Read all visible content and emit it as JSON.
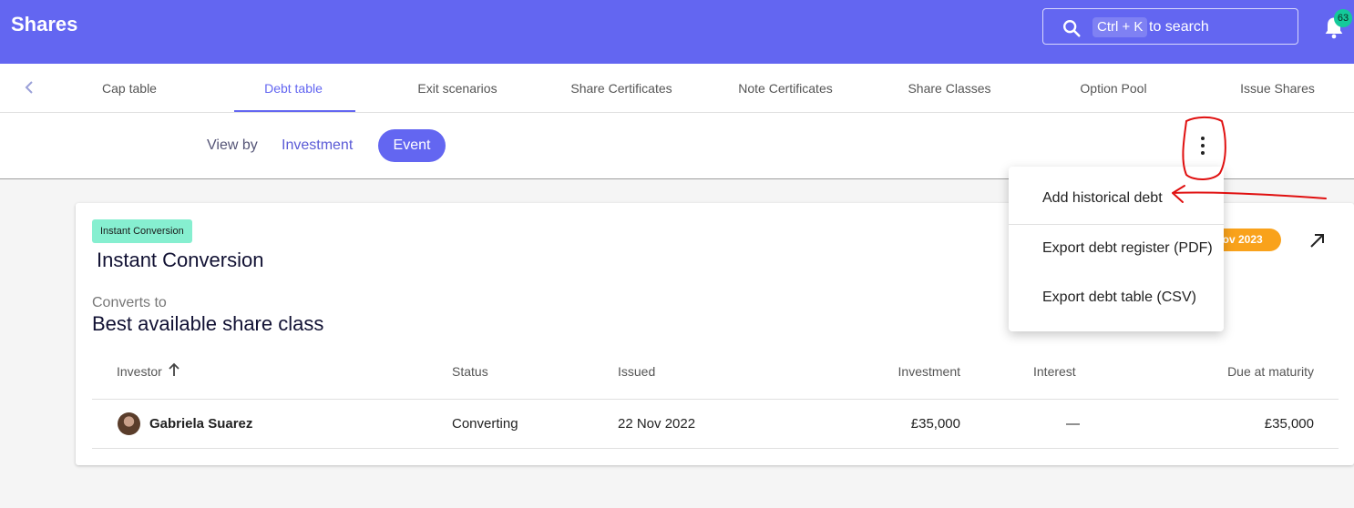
{
  "header": {
    "title": "Shares",
    "search": {
      "shortcut": "Ctrl + K",
      "label": "to search"
    },
    "notifications": {
      "count": "63"
    }
  },
  "tabs": [
    {
      "label": "Cap table"
    },
    {
      "label": "Debt table"
    },
    {
      "label": "Exit scenarios"
    },
    {
      "label": "Share Certificates"
    },
    {
      "label": "Note Certificates"
    },
    {
      "label": "Share Classes"
    },
    {
      "label": "Option Pool"
    },
    {
      "label": "Issue Shares"
    }
  ],
  "active_tab": "Debt table",
  "view_by": {
    "label": "View by",
    "options": [
      "Investment",
      "Event"
    ],
    "selected": "Event"
  },
  "menu": {
    "items": [
      {
        "label": "Add historical debt"
      },
      {
        "label": "Export debt register (PDF)"
      },
      {
        "label": "Export debt table (CSV)"
      }
    ]
  },
  "card": {
    "tag": "Instant Conversion",
    "title": "Instant Conversion",
    "date_chip": "Nov 2023",
    "converts_label": "Converts to",
    "converts_value": "Best available share class",
    "columns": [
      "Investor",
      "Status",
      "Issued",
      "Investment",
      "Interest",
      "Due at maturity"
    ],
    "rows": [
      {
        "investor": "Gabriela Suarez",
        "status": "Converting",
        "issued": "22 Nov 2022",
        "investment": "£35,000",
        "interest": "—",
        "due": "£35,000"
      }
    ]
  },
  "colors": {
    "brand": "#6366f1",
    "tag": "#86efd0",
    "chip": "#f9a21b",
    "badge": "#14c99a",
    "annotation": "#e01010"
  },
  "icons": [
    "search-icon",
    "bell-icon",
    "chevron-left-icon",
    "kebab-icon",
    "arrow-up-icon",
    "open-external-icon"
  ]
}
